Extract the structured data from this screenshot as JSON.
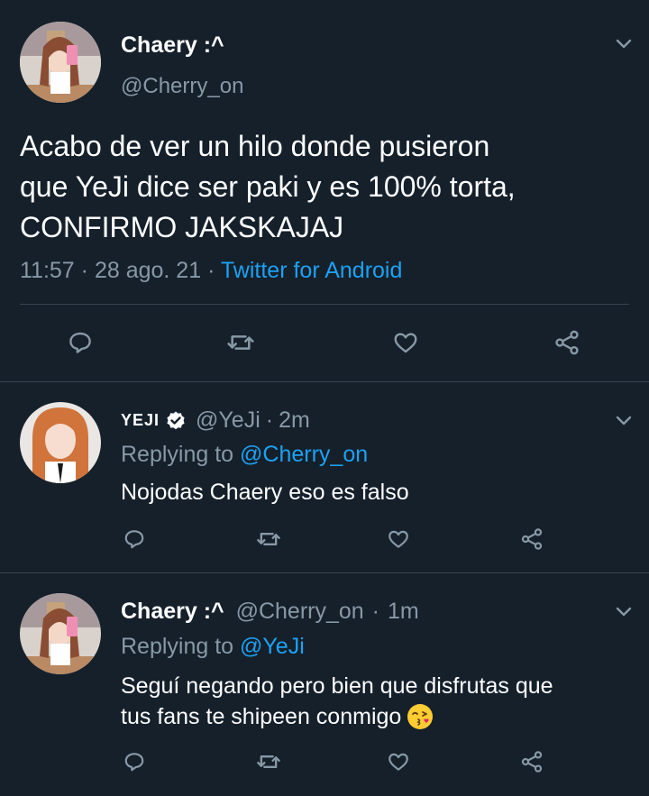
{
  "main_tweet": {
    "display_name": "Chaery :^",
    "handle": "@Cherry_on",
    "text_lines": [
      "Acabo de ver un hilo donde pusieron",
      "que YeJi dice ser paki y es 100% torta,",
      "CONFIRMO JAKSKAJAJ"
    ],
    "time": "11:57",
    "sep1": "·",
    "date": "28 ago. 21",
    "sep2": "·",
    "source": "Twitter for Android"
  },
  "reply1": {
    "display_name": "YEJI",
    "handle": "@YeJi",
    "dot": "·",
    "time": "2m",
    "replying_prefix": "Replying to ",
    "replying_to": "@Cherry_on",
    "text": "Nojodas Chaery eso es falso"
  },
  "reply2": {
    "display_name": "Chaery :^",
    "handle": "@Cherry_on",
    "dot": "·",
    "time": "1m",
    "replying_prefix": "Replying to ",
    "replying_to": "@YeJi",
    "text_line1": "Seguí negando pero bien que disfrutas que",
    "text_line2": "tus fans te shipeen conmigo",
    "emoji": "😘"
  },
  "colors": {
    "background": "#15202b",
    "text": "#ffffff",
    "muted": "#8899a6",
    "link": "#1da1f2",
    "divider": "#38444d"
  },
  "icons": [
    "chevron-down-icon",
    "reply-icon",
    "retweet-icon",
    "like-icon",
    "share-icon",
    "verified-badge-icon"
  ]
}
